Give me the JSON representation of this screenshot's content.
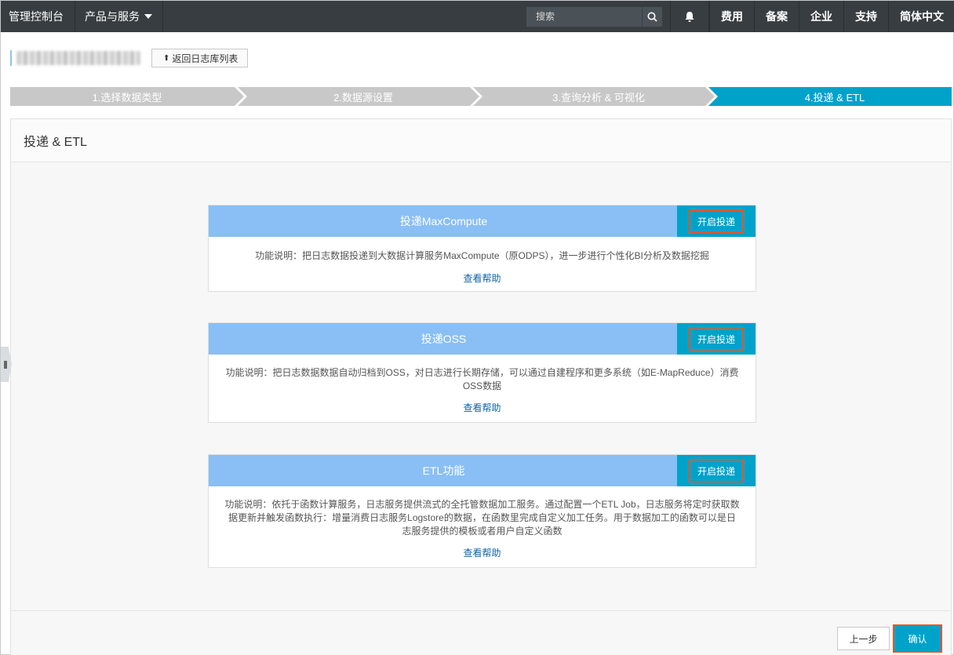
{
  "topbar": {
    "home": "管理控制台",
    "products": "产品与服务",
    "search_placeholder": "搜索",
    "right_items": [
      "费用",
      "备案",
      "企业",
      "支持",
      "简体中文"
    ]
  },
  "header": {
    "back_label": "返回日志库列表"
  },
  "steps": [
    {
      "label": "1.选择数据类型",
      "active": false
    },
    {
      "label": "2.数据源设置",
      "active": false
    },
    {
      "label": "3.查询分析 & 可视化",
      "active": false
    },
    {
      "label": "4.投递 & ETL",
      "active": true
    }
  ],
  "panel": {
    "title": "投递 & ETL"
  },
  "cards": [
    {
      "title": "投递MaxCompute",
      "action": "开启投递",
      "description": "功能说明：把日志数据投递到大数据计算服务MaxCompute（原ODPS），进一步进行个性化BI分析及数据挖掘",
      "help": "查看帮助"
    },
    {
      "title": "投递OSS",
      "action": "开启投递",
      "description": "功能说明：把日志数据数据自动归档到OSS，对日志进行长期存储，可以通过自建程序和更多系统（如E-MapReduce）消费OSS数据",
      "help": "查看帮助"
    },
    {
      "title": "ETL功能",
      "action": "开启投递",
      "description": "功能说明：依托于函数计算服务，日志服务提供流式的全托管数据加工服务。通过配置一个ETL Job，日志服务将定时获取数据更新并触发函数执行：增量消费日志服务Logstore的数据，在函数里完成自定义加工任务。用于数据加工的函数可以是日志服务提供的模板或者用户自定义函数",
      "help": "查看帮助"
    }
  ],
  "footer": {
    "prev_label": "上一步",
    "confirm_label": "确认"
  },
  "colors": {
    "topbar": "#373d41",
    "accent": "#00a2ca",
    "card_header": "#89bff4",
    "highlight": "#e2582b",
    "link": "#0f63a8"
  }
}
